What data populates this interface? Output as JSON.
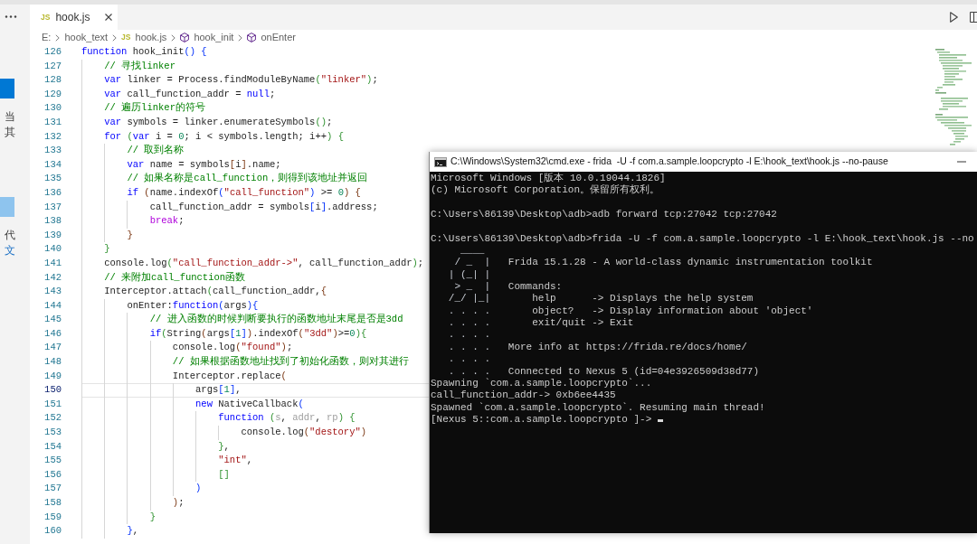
{
  "sidebar": {
    "items": [
      {
        "kind": "primarybutton"
      },
      {
        "kind": "text",
        "text": "当"
      },
      {
        "kind": "text",
        "text": "其"
      },
      {
        "kind": "lightbutton"
      },
      {
        "kind": "text",
        "text": "代"
      },
      {
        "kind": "link",
        "text": "文"
      }
    ]
  },
  "tabs": [
    {
      "icon": "JS",
      "label": "hook.js",
      "selected": true
    }
  ],
  "breadcrumb": [
    {
      "kind": "folder",
      "label": "E:"
    },
    {
      "kind": "folder",
      "label": "hook_text"
    },
    {
      "kind": "file",
      "icon": "JS",
      "label": "hook.js"
    },
    {
      "kind": "symbol",
      "label": "hook_init"
    },
    {
      "kind": "symbol",
      "label": "onEnter"
    }
  ],
  "editor": {
    "lines": [
      {
        "number": "126",
        "current": false,
        "tokens": [
          {
            "kind": "kw",
            "text": "function"
          },
          {
            "kind": "txt",
            "text": " hook_init"
          },
          {
            "kind": "b1",
            "text": "()"
          },
          {
            "kind": "b1",
            "text": " {"
          }
        ]
      },
      {
        "number": "127",
        "current": false,
        "tokens": [
          {
            "kind": "cmt",
            "text": "    // 寻找linker"
          }
        ]
      },
      {
        "number": "128",
        "current": false,
        "tokens": [
          {
            "kind": "kw",
            "text": "    var"
          },
          {
            "kind": "txt",
            "text": " linker = Process.findModuleByName"
          },
          {
            "kind": "b2",
            "text": "("
          },
          {
            "kind": "str",
            "text": "\"linker\""
          },
          {
            "kind": "b2",
            "text": ")"
          },
          {
            "kind": "txt",
            "text": ";"
          }
        ]
      },
      {
        "number": "129",
        "current": false,
        "tokens": [
          {
            "kind": "kw",
            "text": "    var"
          },
          {
            "kind": "txt",
            "text": " call_function_addr = "
          },
          {
            "kind": "kw",
            "text": "null"
          },
          {
            "kind": "txt",
            "text": ";"
          }
        ]
      },
      {
        "number": "130",
        "current": false,
        "tokens": [
          {
            "kind": "cmt",
            "text": "    // 遍历linker的符号"
          }
        ]
      },
      {
        "number": "131",
        "current": false,
        "tokens": [
          {
            "kind": "kw",
            "text": "    var"
          },
          {
            "kind": "txt",
            "text": " symbols = linker.enumerateSymbols"
          },
          {
            "kind": "b2",
            "text": "()"
          },
          {
            "kind": "txt",
            "text": ";"
          }
        ]
      },
      {
        "number": "132",
        "current": false,
        "tokens": [
          {
            "kind": "kw",
            "text": "    for "
          },
          {
            "kind": "b2",
            "text": "("
          },
          {
            "kind": "kw",
            "text": "var"
          },
          {
            "kind": "txt",
            "text": " i = "
          },
          {
            "kind": "num",
            "text": "0"
          },
          {
            "kind": "txt",
            "text": "; i < symbols.length; i++"
          },
          {
            "kind": "b2",
            "text": ")"
          },
          {
            "kind": "b2",
            "text": " {"
          }
        ]
      },
      {
        "number": "133",
        "current": false,
        "tokens": [
          {
            "kind": "cmt",
            "text": "        // 取到名称"
          }
        ]
      },
      {
        "number": "134",
        "current": false,
        "tokens": [
          {
            "kind": "kw",
            "text": "        var"
          },
          {
            "kind": "txt",
            "text": " name = symbols"
          },
          {
            "kind": "b3",
            "text": "["
          },
          {
            "kind": "txt",
            "text": "i"
          },
          {
            "kind": "b3",
            "text": "]"
          },
          {
            "kind": "txt",
            "text": ".name;"
          }
        ]
      },
      {
        "number": "135",
        "current": false,
        "tokens": [
          {
            "kind": "cmt",
            "text": "        // 如果名称是call_function，则得到该地址并返回"
          }
        ]
      },
      {
        "number": "136",
        "current": false,
        "tokens": [
          {
            "kind": "kw",
            "text": "        if "
          },
          {
            "kind": "b3",
            "text": "("
          },
          {
            "kind": "txt",
            "text": "name.indexOf"
          },
          {
            "kind": "b1",
            "text": "("
          },
          {
            "kind": "str",
            "text": "\"call_function\""
          },
          {
            "kind": "b1",
            "text": ")"
          },
          {
            "kind": "txt",
            "text": " >= "
          },
          {
            "kind": "num",
            "text": "0"
          },
          {
            "kind": "b3",
            "text": ")"
          },
          {
            "kind": "b3",
            "text": " {"
          }
        ]
      },
      {
        "number": "137",
        "current": false,
        "tokens": [
          {
            "kind": "txt",
            "text": "            call_function_addr = symbols"
          },
          {
            "kind": "b1",
            "text": "["
          },
          {
            "kind": "txt",
            "text": "i"
          },
          {
            "kind": "b1",
            "text": "]"
          },
          {
            "kind": "txt",
            "text": ".address;"
          }
        ]
      },
      {
        "number": "138",
        "current": false,
        "tokens": [
          {
            "kind": "ctl",
            "text": "            break"
          },
          {
            "kind": "txt",
            "text": ";"
          }
        ]
      },
      {
        "number": "139",
        "current": false,
        "tokens": [
          {
            "kind": "b3",
            "text": "        }"
          }
        ]
      },
      {
        "number": "140",
        "current": false,
        "tokens": [
          {
            "kind": "b2",
            "text": "    }"
          }
        ]
      },
      {
        "number": "141",
        "current": false,
        "tokens": [
          {
            "kind": "txt",
            "text": "    console.log"
          },
          {
            "kind": "b2",
            "text": "("
          },
          {
            "kind": "str",
            "text": "\"call_function_addr->\""
          },
          {
            "kind": "txt",
            "text": ", call_function_addr"
          },
          {
            "kind": "b2",
            "text": ")"
          },
          {
            "kind": "txt",
            "text": ";"
          }
        ]
      },
      {
        "number": "142",
        "current": false,
        "tokens": [
          {
            "kind": "cmt",
            "text": "    // 来附加call_function函数"
          }
        ]
      },
      {
        "number": "143",
        "current": false,
        "tokens": [
          {
            "kind": "txt",
            "text": "    Interceptor.attach"
          },
          {
            "kind": "b2",
            "text": "("
          },
          {
            "kind": "txt",
            "text": "call_function_addr,"
          },
          {
            "kind": "b3",
            "text": "{"
          }
        ]
      },
      {
        "number": "144",
        "current": false,
        "tokens": [
          {
            "kind": "txt",
            "text": "        onEnter:"
          },
          {
            "kind": "kw",
            "text": "function"
          },
          {
            "kind": "b1",
            "text": "("
          },
          {
            "kind": "txt",
            "text": "args"
          },
          {
            "kind": "b1",
            "text": ")"
          },
          {
            "kind": "b1",
            "text": "{"
          }
        ]
      },
      {
        "number": "145",
        "current": false,
        "tokens": [
          {
            "kind": "cmt",
            "text": "            // 进入函数的时候判断要执行的函数地址末尾是否是3dd"
          }
        ]
      },
      {
        "number": "146",
        "current": false,
        "tokens": [
          {
            "kind": "kw",
            "text": "            if"
          },
          {
            "kind": "b2",
            "text": "("
          },
          {
            "kind": "txt",
            "text": "String"
          },
          {
            "kind": "b3",
            "text": "("
          },
          {
            "kind": "txt",
            "text": "args"
          },
          {
            "kind": "b1",
            "text": "["
          },
          {
            "kind": "num",
            "text": "1"
          },
          {
            "kind": "b1",
            "text": "]"
          },
          {
            "kind": "b3",
            "text": ")"
          },
          {
            "kind": "txt",
            "text": ".indexOf"
          },
          {
            "kind": "b3",
            "text": "("
          },
          {
            "kind": "str",
            "text": "\"3dd\""
          },
          {
            "kind": "b3",
            "text": ")"
          },
          {
            "kind": "txt",
            "text": ">="
          },
          {
            "kind": "num",
            "text": "0"
          },
          {
            "kind": "b2",
            "text": ")"
          },
          {
            "kind": "b2",
            "text": "{"
          }
        ]
      },
      {
        "number": "147",
        "current": false,
        "tokens": [
          {
            "kind": "txt",
            "text": "                console.log"
          },
          {
            "kind": "b3",
            "text": "("
          },
          {
            "kind": "str",
            "text": "\"found\""
          },
          {
            "kind": "b3",
            "text": ")"
          },
          {
            "kind": "txt",
            "text": ";"
          }
        ]
      },
      {
        "number": "148",
        "current": false,
        "tokens": [
          {
            "kind": "cmt",
            "text": "                // 如果根据函数地址找到了初始化函数，则对其进行"
          }
        ]
      },
      {
        "number": "149",
        "current": false,
        "tokens": [
          {
            "kind": "txt",
            "text": "                Interceptor.replace"
          },
          {
            "kind": "b3",
            "text": "("
          }
        ]
      },
      {
        "number": "150",
        "current": true,
        "tokens": [
          {
            "kind": "txt",
            "text": "                    args"
          },
          {
            "kind": "b1",
            "text": "["
          },
          {
            "kind": "num",
            "text": "1"
          },
          {
            "kind": "b1",
            "text": "]"
          },
          {
            "kind": "txt",
            "text": ","
          }
        ]
      },
      {
        "number": "151",
        "current": false,
        "tokens": [
          {
            "kind": "kw",
            "text": "                    new"
          },
          {
            "kind": "txt",
            "text": " NativeCallback"
          },
          {
            "kind": "b1",
            "text": "("
          }
        ]
      },
      {
        "number": "152",
        "current": false,
        "tokens": [
          {
            "kind": "kw",
            "text": "                        function "
          },
          {
            "kind": "b2",
            "text": "("
          },
          {
            "kind": "dim",
            "text": "s"
          },
          {
            "kind": "txt",
            "text": ", "
          },
          {
            "kind": "dim",
            "text": "addr"
          },
          {
            "kind": "txt",
            "text": ", "
          },
          {
            "kind": "dim",
            "text": "rp"
          },
          {
            "kind": "b2",
            "text": ")"
          },
          {
            "kind": "b2",
            "text": " {"
          }
        ]
      },
      {
        "number": "153",
        "current": false,
        "tokens": [
          {
            "kind": "txt",
            "text": "                            console.log"
          },
          {
            "kind": "b3",
            "text": "("
          },
          {
            "kind": "str",
            "text": "\"destory\""
          },
          {
            "kind": "b3",
            "text": ")"
          }
        ]
      },
      {
        "number": "154",
        "current": false,
        "tokens": [
          {
            "kind": "b2",
            "text": "                        }"
          },
          {
            "kind": "txt",
            "text": ","
          }
        ]
      },
      {
        "number": "155",
        "current": false,
        "tokens": [
          {
            "kind": "str",
            "text": "                        \"int\""
          },
          {
            "kind": "txt",
            "text": ","
          }
        ]
      },
      {
        "number": "156",
        "current": false,
        "tokens": [
          {
            "kind": "b2",
            "text": "                        []"
          }
        ]
      },
      {
        "number": "157",
        "current": false,
        "tokens": [
          {
            "kind": "b1",
            "text": "                    )"
          }
        ]
      },
      {
        "number": "158",
        "current": false,
        "tokens": [
          {
            "kind": "b3",
            "text": "                )"
          },
          {
            "kind": "txt",
            "text": ";"
          }
        ]
      },
      {
        "number": "159",
        "current": false,
        "tokens": [
          {
            "kind": "b2",
            "text": "            }"
          }
        ]
      },
      {
        "number": "160",
        "current": false,
        "tokens": [
          {
            "kind": "b1",
            "text": "        }"
          },
          {
            "kind": "txt",
            "text": ","
          }
        ]
      }
    ]
  },
  "terminal": {
    "title": "C:\\Windows\\System32\\cmd.exe - frida  -U -f com.a.sample.loopcrypto -l E:\\hook_text\\hook.js --no-pause",
    "lines": [
      {
        "kind": "output",
        "text": "Microsoft Windows [版本 10.0.19044.1826]"
      },
      {
        "kind": "output",
        "text": "(c) Microsoft Corporation。保留所有权利。"
      },
      {
        "kind": "blank"
      },
      {
        "kind": "output",
        "text": "C:\\Users\\86139\\Desktop\\adb>adb forward tcp:27042 tcp:27042"
      },
      {
        "kind": "blank"
      },
      {
        "kind": "output",
        "text": "C:\\Users\\86139\\Desktop\\adb>frida -U -f com.a.sample.loopcrypto -l E:\\hook_text\\hook.js --no"
      },
      {
        "kind": "banner",
        "art": "     ____"
      },
      {
        "kind": "banner",
        "art": "    / _  |",
        "text": "Frida 15.1.28 - A world-class dynamic instrumentation toolkit"
      },
      {
        "kind": "banner",
        "art": "   | (_| |"
      },
      {
        "kind": "banner",
        "art": "    > _  |",
        "text": "Commands:"
      },
      {
        "kind": "banner",
        "art": "   /_/ |_|",
        "text": "    help      -> Displays the help system"
      },
      {
        "kind": "banner",
        "art": "   . . . .",
        "text": "    object?   -> Display information about 'object'"
      },
      {
        "kind": "banner",
        "art": "   . . . .",
        "text": "    exit/quit -> Exit"
      },
      {
        "kind": "banner",
        "art": "   . . . ."
      },
      {
        "kind": "banner",
        "art": "   . . . .",
        "text": "More info at https://frida.re/docs/home/"
      },
      {
        "kind": "banner",
        "art": "   . . . ."
      },
      {
        "kind": "banner",
        "art": "   . . . .",
        "text": "Connected to Nexus 5 (id=04e3926509d38d77)"
      },
      {
        "kind": "output",
        "text": "Spawning `com.a.sample.loopcrypto`..."
      },
      {
        "kind": "output",
        "text": "call_function_addr-> 0xb6ee4435"
      },
      {
        "kind": "output",
        "text": "Spawned `com.a.sample.loopcrypto`. Resuming main thread!"
      },
      {
        "kind": "prompt",
        "text": "[Nexus 5::com.a.sample.loopcrypto ]->"
      }
    ]
  }
}
